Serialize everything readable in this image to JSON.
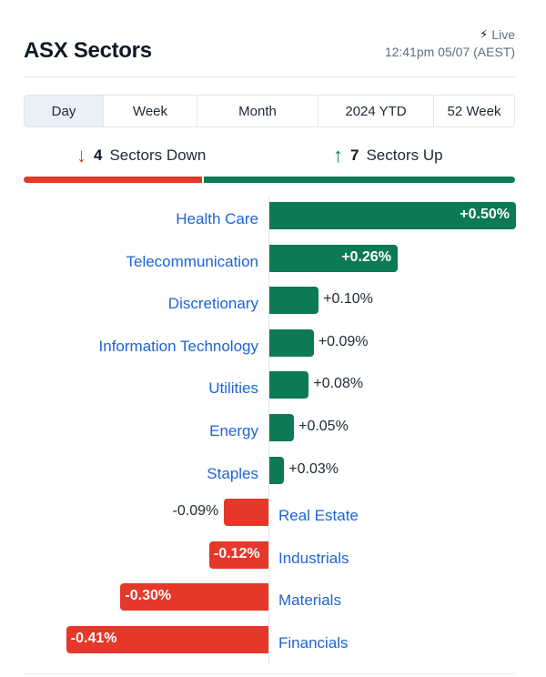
{
  "header": {
    "title": "ASX Sectors",
    "live_icon": "lightning-bolt-icon",
    "live_label": "Live",
    "timestamp": "12:41pm 05/07 (AEST)"
  },
  "tabs": [
    {
      "label": "Day",
      "active": true
    },
    {
      "label": "Week",
      "active": false
    },
    {
      "label": "Month",
      "active": false
    },
    {
      "label": "2024 YTD",
      "active": false
    },
    {
      "label": "52 Week",
      "active": false
    }
  ],
  "summary": {
    "down_count": "4",
    "down_label": "Sectors Down",
    "up_count": "7",
    "up_label": "Sectors Up",
    "colors": {
      "down": "#e5382a",
      "up": "#0b7a55"
    }
  },
  "chart_data": {
    "type": "bar",
    "orientation": "horizontal",
    "title": "ASX Sectors",
    "xlabel": "",
    "ylabel": "",
    "unit": "%",
    "categories": [
      "Health Care",
      "Telecommunication",
      "Discretionary",
      "Information Technology",
      "Utilities",
      "Energy",
      "Staples",
      "Real Estate",
      "Industrials",
      "Materials",
      "Financials"
    ],
    "values": [
      0.5,
      0.26,
      0.1,
      0.09,
      0.08,
      0.05,
      0.03,
      -0.09,
      -0.12,
      -0.3,
      -0.41
    ],
    "labels": [
      "+0.50%",
      "+0.26%",
      "+0.10%",
      "+0.09%",
      "+0.08%",
      "+0.05%",
      "+0.03%",
      "-0.09%",
      "-0.12%",
      "-0.30%",
      "-0.41%"
    ],
    "xlim": [
      -0.5,
      0.5
    ],
    "grid": false,
    "legend": "none",
    "colors": {
      "positive": "#0b7a55",
      "negative": "#e5382a"
    }
  }
}
